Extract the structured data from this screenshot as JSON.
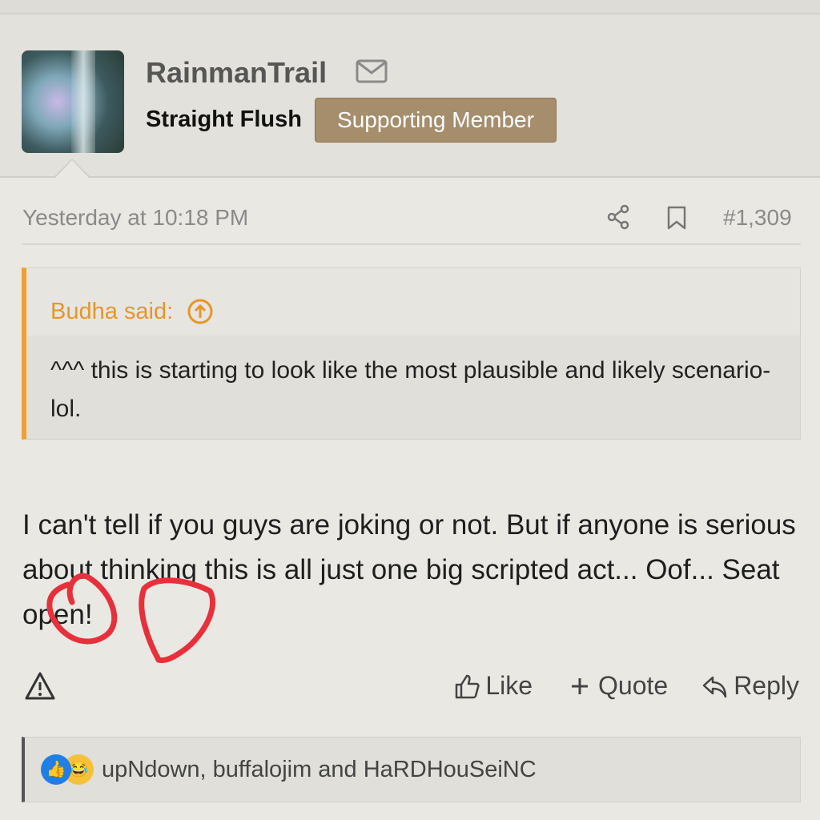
{
  "header": {
    "username": "RainmanTrail",
    "user_title": "Straight Flush",
    "badge": "Supporting Member"
  },
  "post": {
    "date": "Yesterday at 10:18 PM",
    "number": "#1,309",
    "quote": {
      "author_label": "Budha said:",
      "text": "^^^ this is starting to look like the most plausible and likely scenario- lol."
    },
    "message": "I can't tell if you guys are joking or not. But if anyone is serious about thinking this is all just one big scripted act... Oof... Seat open!"
  },
  "actions": {
    "like": "Like",
    "quote": "Quote",
    "reply": "Reply"
  },
  "reactions": {
    "text": "upNdown, buffalojim and HaRDHouSeiNC",
    "icons": [
      "like-reaction-icon",
      "laugh-reaction-icon"
    ]
  },
  "colors": {
    "badge": "#a68e6c",
    "quote_accent": "#f0a030",
    "annotation": "#e8303a"
  }
}
